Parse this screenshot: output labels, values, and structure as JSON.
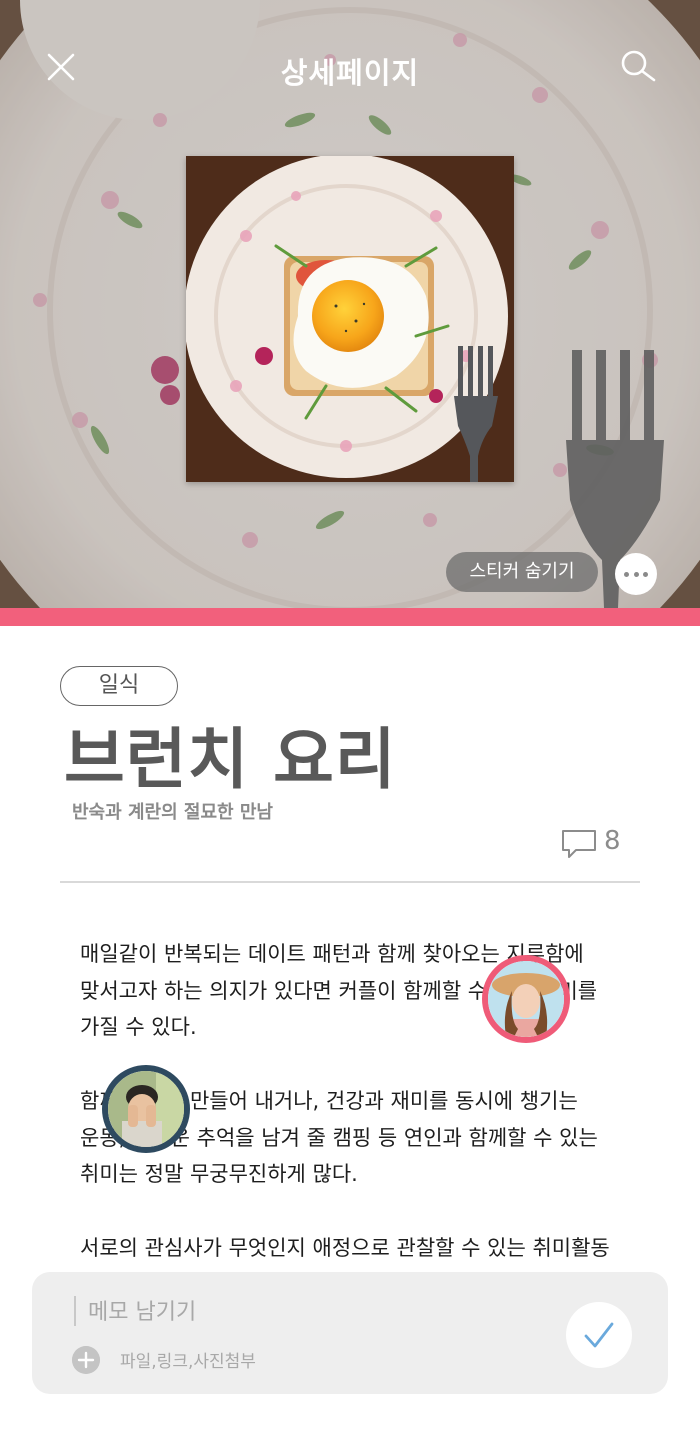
{
  "header": {
    "title": "상세페이지",
    "sticker_toggle_label": "스티커 숨기기"
  },
  "post": {
    "category": "일식",
    "title": "브런치 요리",
    "subtitle": "반숙과 계란의 절묘한 만남",
    "comment_count": "8",
    "paragraphs": [
      [
        "매일같이 반복되는 데이트 패턴과 함께 찾아오는 지루함에",
        "맞서고자 하는 의지가 있다면 커플이 함께할 수 있는 취미를",
        "가질 수 있다."
      ],
      [
        "함께 요리를 만들어 내거나, 건강과 재미를 동시에 챙기는",
        "운동, 즐거운 추억을 남겨 줄 캠핑 등 연인과 함께할 수 있는",
        "취미는 정말 무궁무진하게 많다."
      ],
      [
        "서로의 관심사가 무엇인지 애정으로 관찰할 수 있는 취미활동"
      ]
    ]
  },
  "memo": {
    "placeholder": "메모 남기기",
    "attach_label": "파일,링크,사진첨부"
  },
  "icons": {
    "close": "close-icon",
    "search": "search-icon",
    "more": "more-horizontal-icon",
    "comment": "comment-icon",
    "attach": "plus-icon",
    "submit": "check-icon"
  },
  "colors": {
    "accent_pink": "#f2607c",
    "avatar_ring_pink": "#ef5b78",
    "avatar_ring_navy": "#2e4a60",
    "check_blue": "#6aa9dc"
  }
}
